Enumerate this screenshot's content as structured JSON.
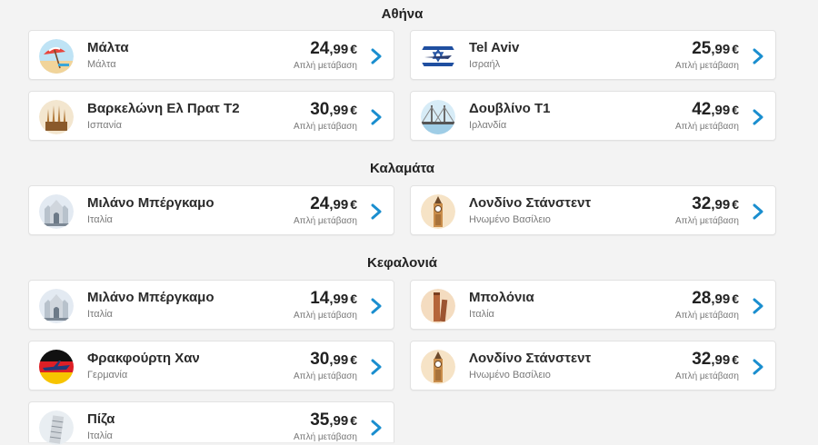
{
  "colors": {
    "accent": "#1a8ecf",
    "card_bg": "#ffffff",
    "page_bg": "#f3f3f3"
  },
  "sections": [
    {
      "title": "Αθήνα",
      "flights": [
        {
          "city": "Μάλτα",
          "country": "Μάλτα",
          "price_int": "24",
          "price_dec": ",99",
          "currency": "€",
          "fare_type": "Απλή μετάβαση",
          "icon": "beach-umbrella-icon"
        },
        {
          "city": "Tel Aviv",
          "country": "Ισραήλ",
          "price_int": "25",
          "price_dec": ",99",
          "currency": "€",
          "fare_type": "Απλή μετάβαση",
          "icon": "israel-flag-icon"
        },
        {
          "city": "Βαρκελώνη Ελ Πρατ Τ2",
          "country": "Ισπανία",
          "price_int": "30",
          "price_dec": ",99",
          "currency": "€",
          "fare_type": "Απλή μετάβαση",
          "icon": "sagrada-familia-icon"
        },
        {
          "city": "Δουβλίνο Τ1",
          "country": "Ιρλανδία",
          "price_int": "42",
          "price_dec": ",99",
          "currency": "€",
          "fare_type": "Απλή μετάβαση",
          "icon": "bridge-icon"
        }
      ]
    },
    {
      "title": "Καλαμάτα",
      "flights": [
        {
          "city": "Μιλάνο Μπέργκαμο",
          "country": "Ιταλία",
          "price_int": "24",
          "price_dec": ",99",
          "currency": "€",
          "fare_type": "Απλή μετάβαση",
          "icon": "milan-cathedral-icon"
        },
        {
          "city": "Λονδίνο Στάνστεντ",
          "country": "Ηνωμένο Βασίλειο",
          "price_int": "32",
          "price_dec": ",99",
          "currency": "€",
          "fare_type": "Απλή μετάβαση",
          "icon": "big-ben-icon"
        }
      ]
    },
    {
      "title": "Κεφαλονιά",
      "flights": [
        {
          "city": "Μιλάνο Μπέργκαμο",
          "country": "Ιταλία",
          "price_int": "14",
          "price_dec": ",99",
          "currency": "€",
          "fare_type": "Απλή μετάβαση",
          "icon": "milan-cathedral-icon"
        },
        {
          "city": "Μπολόνια",
          "country": "Ιταλία",
          "price_int": "28",
          "price_dec": ",99",
          "currency": "€",
          "fare_type": "Απλή μετάβαση",
          "icon": "bologna-towers-icon"
        },
        {
          "city": "Φρακφούρτη Χαν",
          "country": "Γερμανία",
          "price_int": "30",
          "price_dec": ",99",
          "currency": "€",
          "fare_type": "Απλή μετάβαση",
          "icon": "germany-flag-plane-icon"
        },
        {
          "city": "Λονδίνο Στάνστεντ",
          "country": "Ηνωμένο Βασίλειο",
          "price_int": "32",
          "price_dec": ",99",
          "currency": "€",
          "fare_type": "Απλή μετάβαση",
          "icon": "big-ben-icon"
        },
        {
          "city": "Πίζα",
          "country": "Ιταλία",
          "price_int": "35",
          "price_dec": ",99",
          "currency": "€",
          "fare_type": "Απλή μετάβαση",
          "icon": "leaning-tower-icon"
        }
      ]
    }
  ]
}
